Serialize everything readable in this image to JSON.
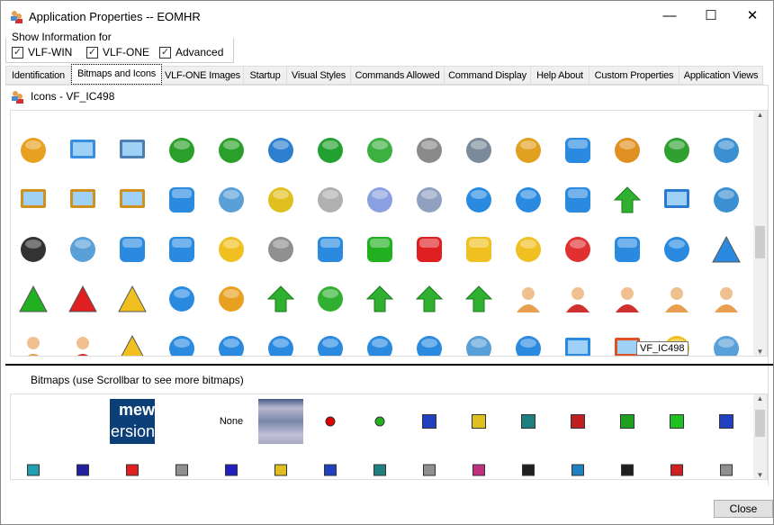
{
  "window": {
    "title": "Application Properties -- EOMHR",
    "minimize": "—",
    "maximize": "☐",
    "close": "✕"
  },
  "show_info": {
    "legend": "Show Information for",
    "options": [
      {
        "label": "VLF-WIN",
        "checked": true
      },
      {
        "label": "VLF-ONE",
        "checked": true
      },
      {
        "label": "Advanced",
        "checked": true
      }
    ]
  },
  "tabs": [
    "Identification",
    "Bitmaps and Icons",
    "VLF-ONE Images",
    "Startup",
    "Visual Styles",
    "Commands Allowed",
    "Command Display",
    "Help About",
    "Custom Properties",
    "Application Views"
  ],
  "active_tab": 1,
  "icons_header": "Icons  -  VF_IC498",
  "tooltip": "VF_IC498",
  "icons": [
    [
      "lock-icon",
      "#e8a020"
    ],
    [
      "monitor-icon",
      "#3a8ee0"
    ],
    [
      "monitor-icon",
      "#4a7fb0"
    ],
    [
      "music-note-icon",
      "#2aa02a"
    ],
    [
      "music-notes-icon",
      "#2aa02a"
    ],
    [
      "network-computer-icon",
      "#2d7fd0"
    ],
    [
      "check-circle-icon",
      "#22a030"
    ],
    [
      "checkmark-icon",
      "#3cb040"
    ],
    [
      "safe-icon",
      "#8a8a8a"
    ],
    [
      "gears-icon",
      "#7a8a9a"
    ],
    [
      "clipboard-icon",
      "#e0a020"
    ],
    [
      "pause-icon",
      "#2a8ae0"
    ],
    [
      "pencil-icon",
      "#e09020"
    ],
    [
      "pencil-green-icon",
      "#30a030"
    ],
    [
      "telephone-icon",
      "#3a90d0"
    ],
    [
      "picture-icon",
      "#d09020"
    ],
    [
      "picture-icon",
      "#d09020"
    ],
    [
      "picture-search-icon",
      "#d09020"
    ],
    [
      "play-icon",
      "#2a8ae0"
    ],
    [
      "magnifier-icon",
      "#5aa0d8"
    ],
    [
      "printer-icon",
      "#e0c020"
    ],
    [
      "document-search-icon",
      "#b0b0b0"
    ],
    [
      "recycle-bin-icon",
      "#8aa0e0"
    ],
    [
      "recycle-bin-full-icon",
      "#90a0c0"
    ],
    [
      "redo-icon",
      "#2a8ae0"
    ],
    [
      "refresh-icon",
      "#2a8ae0"
    ],
    [
      "rewind-icon",
      "#2a8ae0"
    ],
    [
      "arrow-right-icon",
      "#30b030"
    ],
    [
      "floppy-disk-icon",
      "#2a7ad0"
    ],
    [
      "scanner-icon",
      "#3a90d0"
    ],
    [
      "binoculars-icon",
      "#333333"
    ],
    [
      "cd-icon",
      "#5aa0d8"
    ],
    [
      "skip-back-icon",
      "#2a8ae0"
    ],
    [
      "skip-forward-icon",
      "#2a8ae0"
    ],
    [
      "smiley-icon",
      "#f0c020"
    ],
    [
      "speaker-icon",
      "#909090"
    ],
    [
      "square-blue-icon",
      "#2a8ae0"
    ],
    [
      "square-green-icon",
      "#20b020"
    ],
    [
      "square-red-icon",
      "#e02020"
    ],
    [
      "square-yellow-icon",
      "#f0c020"
    ],
    [
      "star-icon",
      "#f0c020"
    ],
    [
      "bar-chart-icon",
      "#e03030"
    ],
    [
      "stop-icon",
      "#2a8ae0"
    ],
    [
      "alarm-clock-icon",
      "#2a8ae0"
    ],
    [
      "triangle-blue-icon",
      "#2a8ae0"
    ],
    [
      "triangle-green-icon",
      "#20b020"
    ],
    [
      "triangle-red-icon",
      "#e02020"
    ],
    [
      "triangle-yellow-icon",
      "#f0c020"
    ],
    [
      "undo-icon",
      "#2a8ae0"
    ],
    [
      "unlock-icon",
      "#e8a020"
    ],
    [
      "arrow-up-icon",
      "#30b030"
    ],
    [
      "up-circle-icon",
      "#30b030"
    ],
    [
      "arrows-up-down-icon",
      "#30b030"
    ],
    [
      "arrow-up-left-icon",
      "#30b030"
    ],
    [
      "arrow-up-right-icon",
      "#30b030"
    ],
    [
      "user-icon",
      "#e8a050"
    ],
    [
      "user-red-icon",
      "#d03030"
    ],
    [
      "users-icon",
      "#d03030"
    ],
    [
      "user-add-icon",
      "#e8a050"
    ],
    [
      "user-remove-icon",
      "#e8a050"
    ],
    [
      "user-edit-icon",
      "#e8a050"
    ],
    [
      "user-search-icon",
      "#d03030"
    ],
    [
      "warning-icon",
      "#f0c020"
    ],
    [
      "globe-icon",
      "#2a8ae0"
    ],
    [
      "globe-icon",
      "#2a8ae0"
    ],
    [
      "globe-down-icon",
      "#2a8ae0"
    ],
    [
      "globe-music-icon",
      "#2a8ae0"
    ],
    [
      "globe-music-icon",
      "#2a8ae0"
    ],
    [
      "globe-search-icon",
      "#2a8ae0"
    ],
    [
      "search-icon",
      "#5aa0d8"
    ],
    [
      "globe-up-icon",
      "#2a8ae0"
    ],
    [
      "window-icon",
      "#2a8ae0"
    ],
    [
      "windows-logo-icon",
      "#e05020"
    ],
    [
      "mouse-cursor-icon",
      "#f0c020"
    ],
    [
      "zoom-out-icon",
      "#5aa0d8"
    ]
  ],
  "bitmaps_label": "Bitmaps (use Scrollbar to see more bitmaps)",
  "bitmaps_row1": [
    {
      "type": "banner",
      "line1": "mew",
      "line2": "ersion"
    },
    {
      "type": "text",
      "text": "None"
    },
    {
      "type": "photo"
    },
    {
      "type": "dot",
      "color": "#e00000"
    },
    {
      "type": "dot",
      "color": "#20b020"
    },
    {
      "type": "glyph",
      "color": "#2040c0"
    },
    {
      "type": "glyph",
      "color": "#e0c020"
    },
    {
      "type": "glyph",
      "color": "#208080"
    },
    {
      "type": "glyph",
      "color": "#c02020"
    },
    {
      "type": "glyph",
      "color": "#20a020"
    },
    {
      "type": "glyph",
      "color": "#20c020"
    },
    {
      "type": "glyph",
      "color": "#2040c0"
    }
  ],
  "bitmaps_row2": [
    "#20a0b0",
    "#2020a0",
    "#e02020",
    "#909090",
    "#2020c0",
    "#e0c020",
    "#2040c0",
    "#208080",
    "#909090",
    "#c03080",
    "#202020",
    "#2080c0",
    "#202020",
    "#d02020",
    "#909090"
  ],
  "close_button": "Close"
}
